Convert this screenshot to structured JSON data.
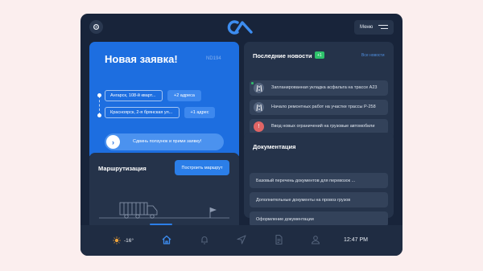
{
  "header": {
    "menu_label": "Меню"
  },
  "new_request": {
    "title": "Новая заявка!",
    "code": "ND194",
    "from_address": "Ангарск, 108-й кварт...",
    "to_address": "Красноярск, 2-я брянская ул...",
    "from_extra": "+2 адреса",
    "to_extra": "+1 адрес",
    "slider_text": "Сдвинь ползунок и прими заявку!",
    "slider_icon": "chevron-right-icon"
  },
  "news": {
    "title": "Последние новости",
    "badge": "+1",
    "all_link": "Все новости",
    "items": [
      {
        "text": "Запланированная укладка асфальта на трассе А23",
        "icon": "road-icon",
        "new": true
      },
      {
        "text": "Начало ремонтных работ на участке трассы Р-258",
        "icon": "road-icon",
        "new": false
      },
      {
        "text": "Ввод новых ограничений на грузовые автомобили",
        "icon": "warning-icon",
        "new": false
      }
    ]
  },
  "routing": {
    "title": "Маршрутизация",
    "build_button": "Построить маршрут"
  },
  "documents": {
    "title": "Документация",
    "items": [
      "Базовый перечень документов для перевозок ...",
      "Дополнительные документы на провоз грузов",
      "Оформление документации"
    ]
  },
  "bottom_bar": {
    "temperature": "-16°",
    "weather_icon": "sun-icon",
    "time": "12:47 PM",
    "nav": [
      "home-icon",
      "bell-icon",
      "navigation-icon",
      "document-icon",
      "user-icon"
    ],
    "active_nav": "home-icon"
  },
  "colors": {
    "background": "#fbeeee",
    "device": "#18243a",
    "card": "#25334a",
    "accent": "#1d6ee0",
    "badge": "#2ec26b"
  }
}
